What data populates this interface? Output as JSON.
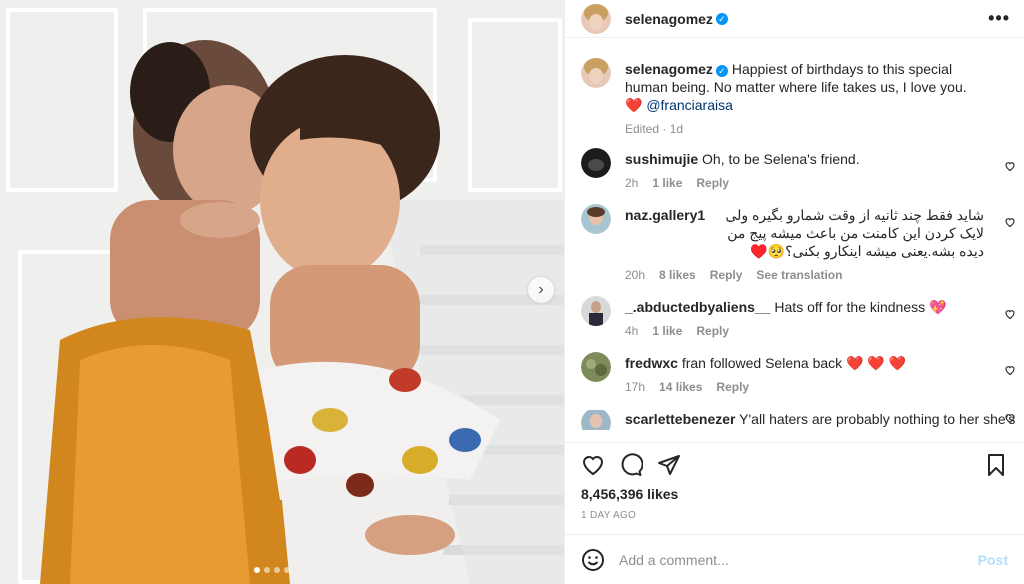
{
  "header": {
    "username": "selenagomez",
    "more_label": "•••"
  },
  "caption": {
    "username": "selenagomez",
    "text": "Happiest of birthdays to this special human being. No matter where life takes us, I love you.",
    "emoji": "❤️",
    "mention": "@franciaraisa",
    "meta": "Edited · 1d"
  },
  "comments": [
    {
      "username": "sushimujie",
      "text": "Oh, to be Selena's friend.",
      "time": "2h",
      "likes": "1 like",
      "reply": "Reply"
    },
    {
      "username": "naz.gallery1",
      "text": "شاید فقط چند ثانیه از وقت شمارو بگیره ولی لایک کردن این کامنت من باعث میشه پیج من دیده بشه.یعنی میشه اینکارو بکنی؟🥺♥️",
      "time": "20h",
      "likes": "8 likes",
      "reply": "Reply",
      "translate": "See translation"
    },
    {
      "username": "_.abductedbyaliens__",
      "text": "Hats off for the kindness 💖",
      "time": "4h",
      "likes": "1 like",
      "reply": "Reply"
    },
    {
      "username": "fredwxc",
      "text": "fran followed Selena back ❤️ ❤️ ❤️",
      "time": "17h",
      "likes": "14 likes",
      "reply": "Reply"
    },
    {
      "username": "scarlettebenezer",
      "text": "Y'all haters are probably nothing to her she's"
    }
  ],
  "likes_label": "8,456,396 likes",
  "time_ago": "1 DAY AGO",
  "add_comment": {
    "placeholder": "Add a comment...",
    "post_label": "Post"
  },
  "carousel": {
    "next_label": "›",
    "slide_count": 4,
    "active_slide": 0
  },
  "icons": [
    "heart-icon",
    "comment-icon",
    "share-icon",
    "bookmark-icon",
    "emoji-icon",
    "verified-icon",
    "chevron-right-icon"
  ],
  "colors": {
    "verified": "#0095f6",
    "heart": "#ed4956",
    "post_disabled": "#b2dffc",
    "muted": "#8e8e8e"
  }
}
